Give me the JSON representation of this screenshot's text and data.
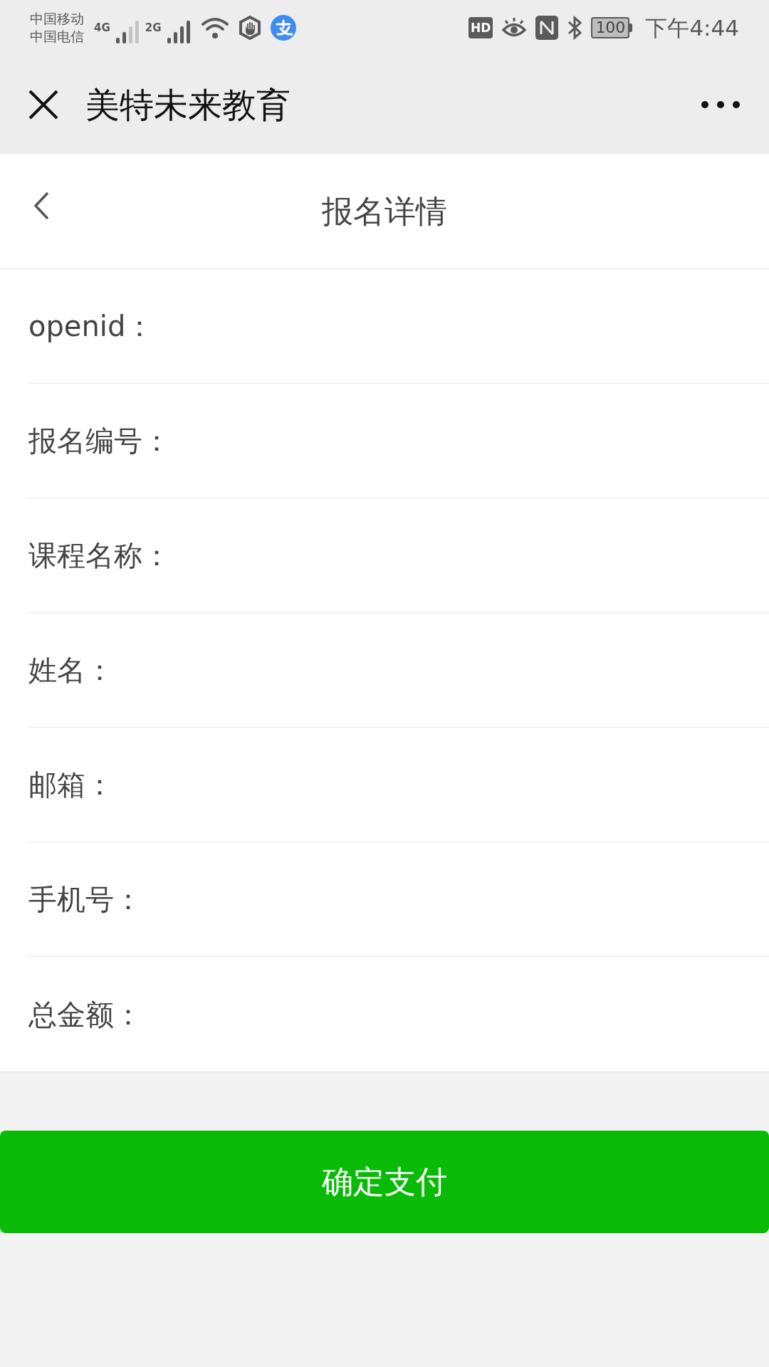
{
  "status_bar": {
    "carriers": [
      "中国移动",
      "中国电信"
    ],
    "network_labels": [
      "4G",
      "2G"
    ],
    "hd_label": "HD",
    "battery": "100",
    "time": "下午4:44"
  },
  "app_bar": {
    "title": "美特未来教育"
  },
  "page_header": {
    "title": "报名详情"
  },
  "fields": [
    {
      "label": "openid："
    },
    {
      "label": "报名编号："
    },
    {
      "label": "课程名称："
    },
    {
      "label": "姓名："
    },
    {
      "label": "邮箱："
    },
    {
      "label": "手机号："
    },
    {
      "label": "总金额："
    }
  ],
  "pay_button": {
    "label": "确定支付"
  }
}
